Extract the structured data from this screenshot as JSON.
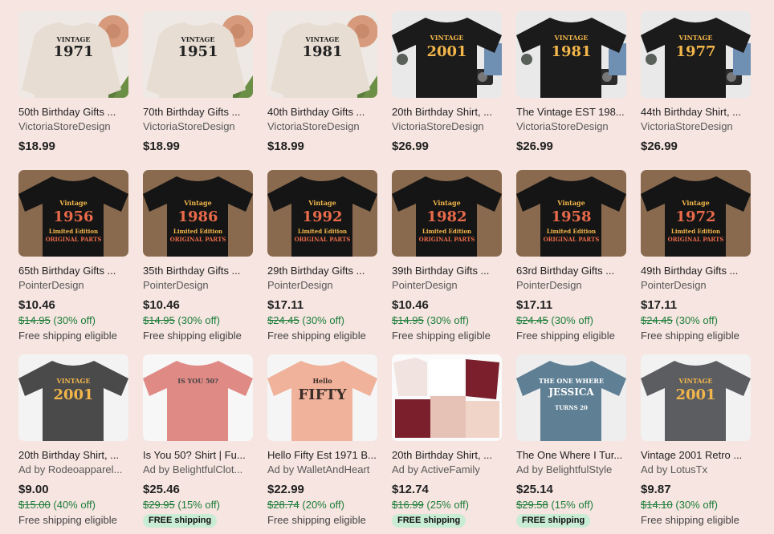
{
  "rows": [
    [
      {
        "img": "sweat",
        "img_text_top": "VINTAGE",
        "img_text": "1971",
        "title": "50th Birthday Gifts ...",
        "shop": "VictoriaStoreDesign",
        "price": "$18.99"
      },
      {
        "img": "sweat",
        "img_text_top": "VINTAGE",
        "img_text": "1951",
        "title": "70th Birthday Gifts ...",
        "shop": "VictoriaStoreDesign",
        "price": "$18.99"
      },
      {
        "img": "sweat",
        "img_text_top": "VINTAGE",
        "img_text": "1981",
        "title": "40th Birthday Gifts ...",
        "shop": "VictoriaStoreDesign",
        "price": "$18.99"
      },
      {
        "img": "flat",
        "img_text_top": "VINTAGE",
        "img_text": "2001",
        "title": "20th Birthday Shirt, ...",
        "shop": "VictoriaStoreDesign",
        "price": "$26.99"
      },
      {
        "img": "flat",
        "img_text_top": "VINTAGE",
        "img_text": "1981",
        "title": "The Vintage EST 198...",
        "shop": "VictoriaStoreDesign",
        "price": "$26.99"
      },
      {
        "img": "flat",
        "img_text_top": "VINTAGE",
        "img_text": "1977",
        "title": "44th Birthday Shirt, ...",
        "shop": "VictoriaStoreDesign",
        "price": "$26.99"
      }
    ],
    [
      {
        "img": "black",
        "img_text_top": "Vintage",
        "img_text": "1956",
        "img_text_sub": "Limited Edition",
        "img_text_sub2": "ORIGINAL PARTS",
        "title": "65th Birthday Gifts ...",
        "shop": "PointerDesign",
        "price": "$10.46",
        "orig": "$14.95",
        "discount": "(30% off)",
        "shipping": "Free shipping eligible"
      },
      {
        "img": "black",
        "img_text_top": "Vintage",
        "img_text": "1986",
        "img_text_sub": "Limited Edition",
        "img_text_sub2": "ORIGINAL PARTS",
        "title": "35th Birthday Gifts ...",
        "shop": "PointerDesign",
        "price": "$10.46",
        "orig": "$14.95",
        "discount": "(30% off)",
        "shipping": "Free shipping eligible"
      },
      {
        "img": "black",
        "img_text_top": "Vintage",
        "img_text": "1992",
        "img_text_sub": "Limited Edition",
        "img_text_sub2": "ORIGINAL PARTS",
        "title": "29th Birthday Gifts ...",
        "shop": "PointerDesign",
        "price": "$17.11",
        "orig": "$24.45",
        "discount": "(30% off)",
        "shipping": "Free shipping eligible"
      },
      {
        "img": "black",
        "img_text_top": "Vintage",
        "img_text": "1982",
        "img_text_sub": "Limited Edition",
        "img_text_sub2": "ORIGINAL PARTS",
        "title": "39th Birthday Gifts ...",
        "shop": "PointerDesign",
        "price": "$10.46",
        "orig": "$14.95",
        "discount": "(30% off)",
        "shipping": "Free shipping eligible"
      },
      {
        "img": "black",
        "img_text_top": "Vintage",
        "img_text": "1958",
        "img_text_sub": "Limited Edition",
        "img_text_sub2": "ORIGINAL PARTS",
        "title": "63rd Birthday Gifts ...",
        "shop": "PointerDesign",
        "price": "$17.11",
        "orig": "$24.45",
        "discount": "(30% off)",
        "shipping": "Free shipping eligible"
      },
      {
        "img": "black",
        "img_text_top": "Vintage",
        "img_text": "1972",
        "img_text_sub": "Limited Edition",
        "img_text_sub2": "ORIGINAL PARTS",
        "title": "49th Birthday Gifts ...",
        "shop": "PointerDesign",
        "price": "$17.11",
        "orig": "$24.45",
        "discount": "(30% off)",
        "shipping": "Free shipping eligible"
      }
    ],
    [
      {
        "img": "grey",
        "img_text_top": "VINTAGE",
        "img_text": "2001",
        "title": "20th Birthday Shirt, ...",
        "shop": "Ad by Rodeoapparel...",
        "price": "$9.00",
        "orig": "$15.00",
        "discount": "(40% off)",
        "shipping": "Free shipping eligible"
      },
      {
        "img": "pink",
        "img_text_top": "IS YOU 50?",
        "img_text": "",
        "title": "Is You 50? Shirt | Fu...",
        "shop": "Ad by BelightfulClot...",
        "price": "$25.46",
        "orig": "$29.95",
        "discount": "(15% off)",
        "badge": "FREE shipping"
      },
      {
        "img": "peach",
        "img_text_top": "Hello",
        "img_text": "FIFTY",
        "title": "Hello Fifty Est 1971 B...",
        "shop": "Ad by WalletAndHeart",
        "price": "$22.99",
        "orig": "$28.74",
        "discount": "(20% off)",
        "shipping": "Free shipping eligible"
      },
      {
        "img": "multi",
        "img_text_top": "",
        "img_text": "",
        "title": "20th Birthday Shirt, ...",
        "shop": "Ad by ActiveFamily",
        "price": "$12.74",
        "orig": "$16.99",
        "discount": "(25% off)",
        "badge": "FREE shipping"
      },
      {
        "img": "blue",
        "img_text_top": "THE ONE WHERE",
        "img_text": "JESSICA",
        "img_text_sub": "TURNS 20",
        "title": "The One Where I Tur...",
        "shop": "Ad by BelightfulStyle",
        "price": "$25.14",
        "orig": "$29.58",
        "discount": "(15% off)",
        "badge": "FREE shipping"
      },
      {
        "img": "greyretro",
        "img_text_top": "VINTAGE",
        "img_text": "2001",
        "title": "Vintage 2001 Retro ...",
        "shop": "Ad by LotusTx",
        "price": "$9.87",
        "orig": "$14.10",
        "discount": "(30% off)",
        "shipping": "Free shipping eligible"
      }
    ]
  ]
}
